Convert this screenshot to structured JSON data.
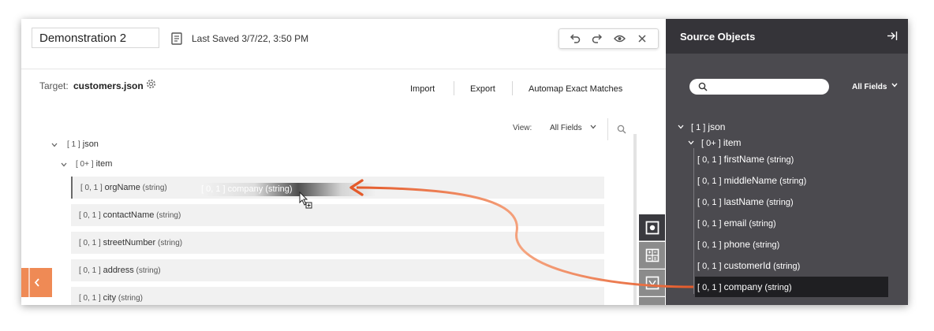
{
  "header": {
    "project_name": "Demonstration 2",
    "last_saved": "Last Saved 3/7/22, 3:50 PM"
  },
  "target": {
    "label": "Target:",
    "file": "customers.json",
    "actions": [
      "Import",
      "Export",
      "Automap Exact Matches"
    ]
  },
  "view": {
    "label": "View:",
    "selected": "All Fields"
  },
  "tree": {
    "root": {
      "card": "[ 1 ]",
      "name": "json"
    },
    "item": {
      "card": "[ 0+ ]",
      "name": "item"
    },
    "fields": [
      {
        "card": "[ 0, 1 ]",
        "name": "orgName",
        "type": "(string)"
      },
      {
        "card": "[ 0, 1 ]",
        "name": "contactName",
        "type": "(string)"
      },
      {
        "card": "[ 0, 1 ]",
        "name": "streetNumber",
        "type": "(string)"
      },
      {
        "card": "[ 0, 1 ]",
        "name": "address",
        "type": "(string)"
      },
      {
        "card": "[ 0, 1 ]",
        "name": "city",
        "type": "(string)"
      }
    ],
    "drag_label": "[ 0, 1 ] company (string)"
  },
  "source_panel": {
    "title": "Source Objects",
    "filter": "All Fields",
    "root": {
      "card": "[ 1 ]",
      "name": "json"
    },
    "item": {
      "card": "[ 0+ ]",
      "name": "item"
    },
    "fields": [
      {
        "card": "[ 0, 1 ]",
        "name": "firstName",
        "type": "(string)"
      },
      {
        "card": "[ 0, 1 ]",
        "name": "middleName",
        "type": "(string)"
      },
      {
        "card": "[ 0, 1 ]",
        "name": "lastName",
        "type": "(string)"
      },
      {
        "card": "[ 0, 1 ]",
        "name": "email",
        "type": "(string)"
      },
      {
        "card": "[ 0, 1 ]",
        "name": "phone",
        "type": "(string)"
      },
      {
        "card": "[ 0, 1 ]",
        "name": "customerId",
        "type": "(string)"
      },
      {
        "card": "[ 0, 1 ]",
        "name": "company",
        "type": "(string)"
      }
    ]
  },
  "colors": {
    "accent": "#ef8a55",
    "arrow": "#e8693a",
    "panel_bg": "#4b4a4f",
    "panel_header": "#353439"
  }
}
